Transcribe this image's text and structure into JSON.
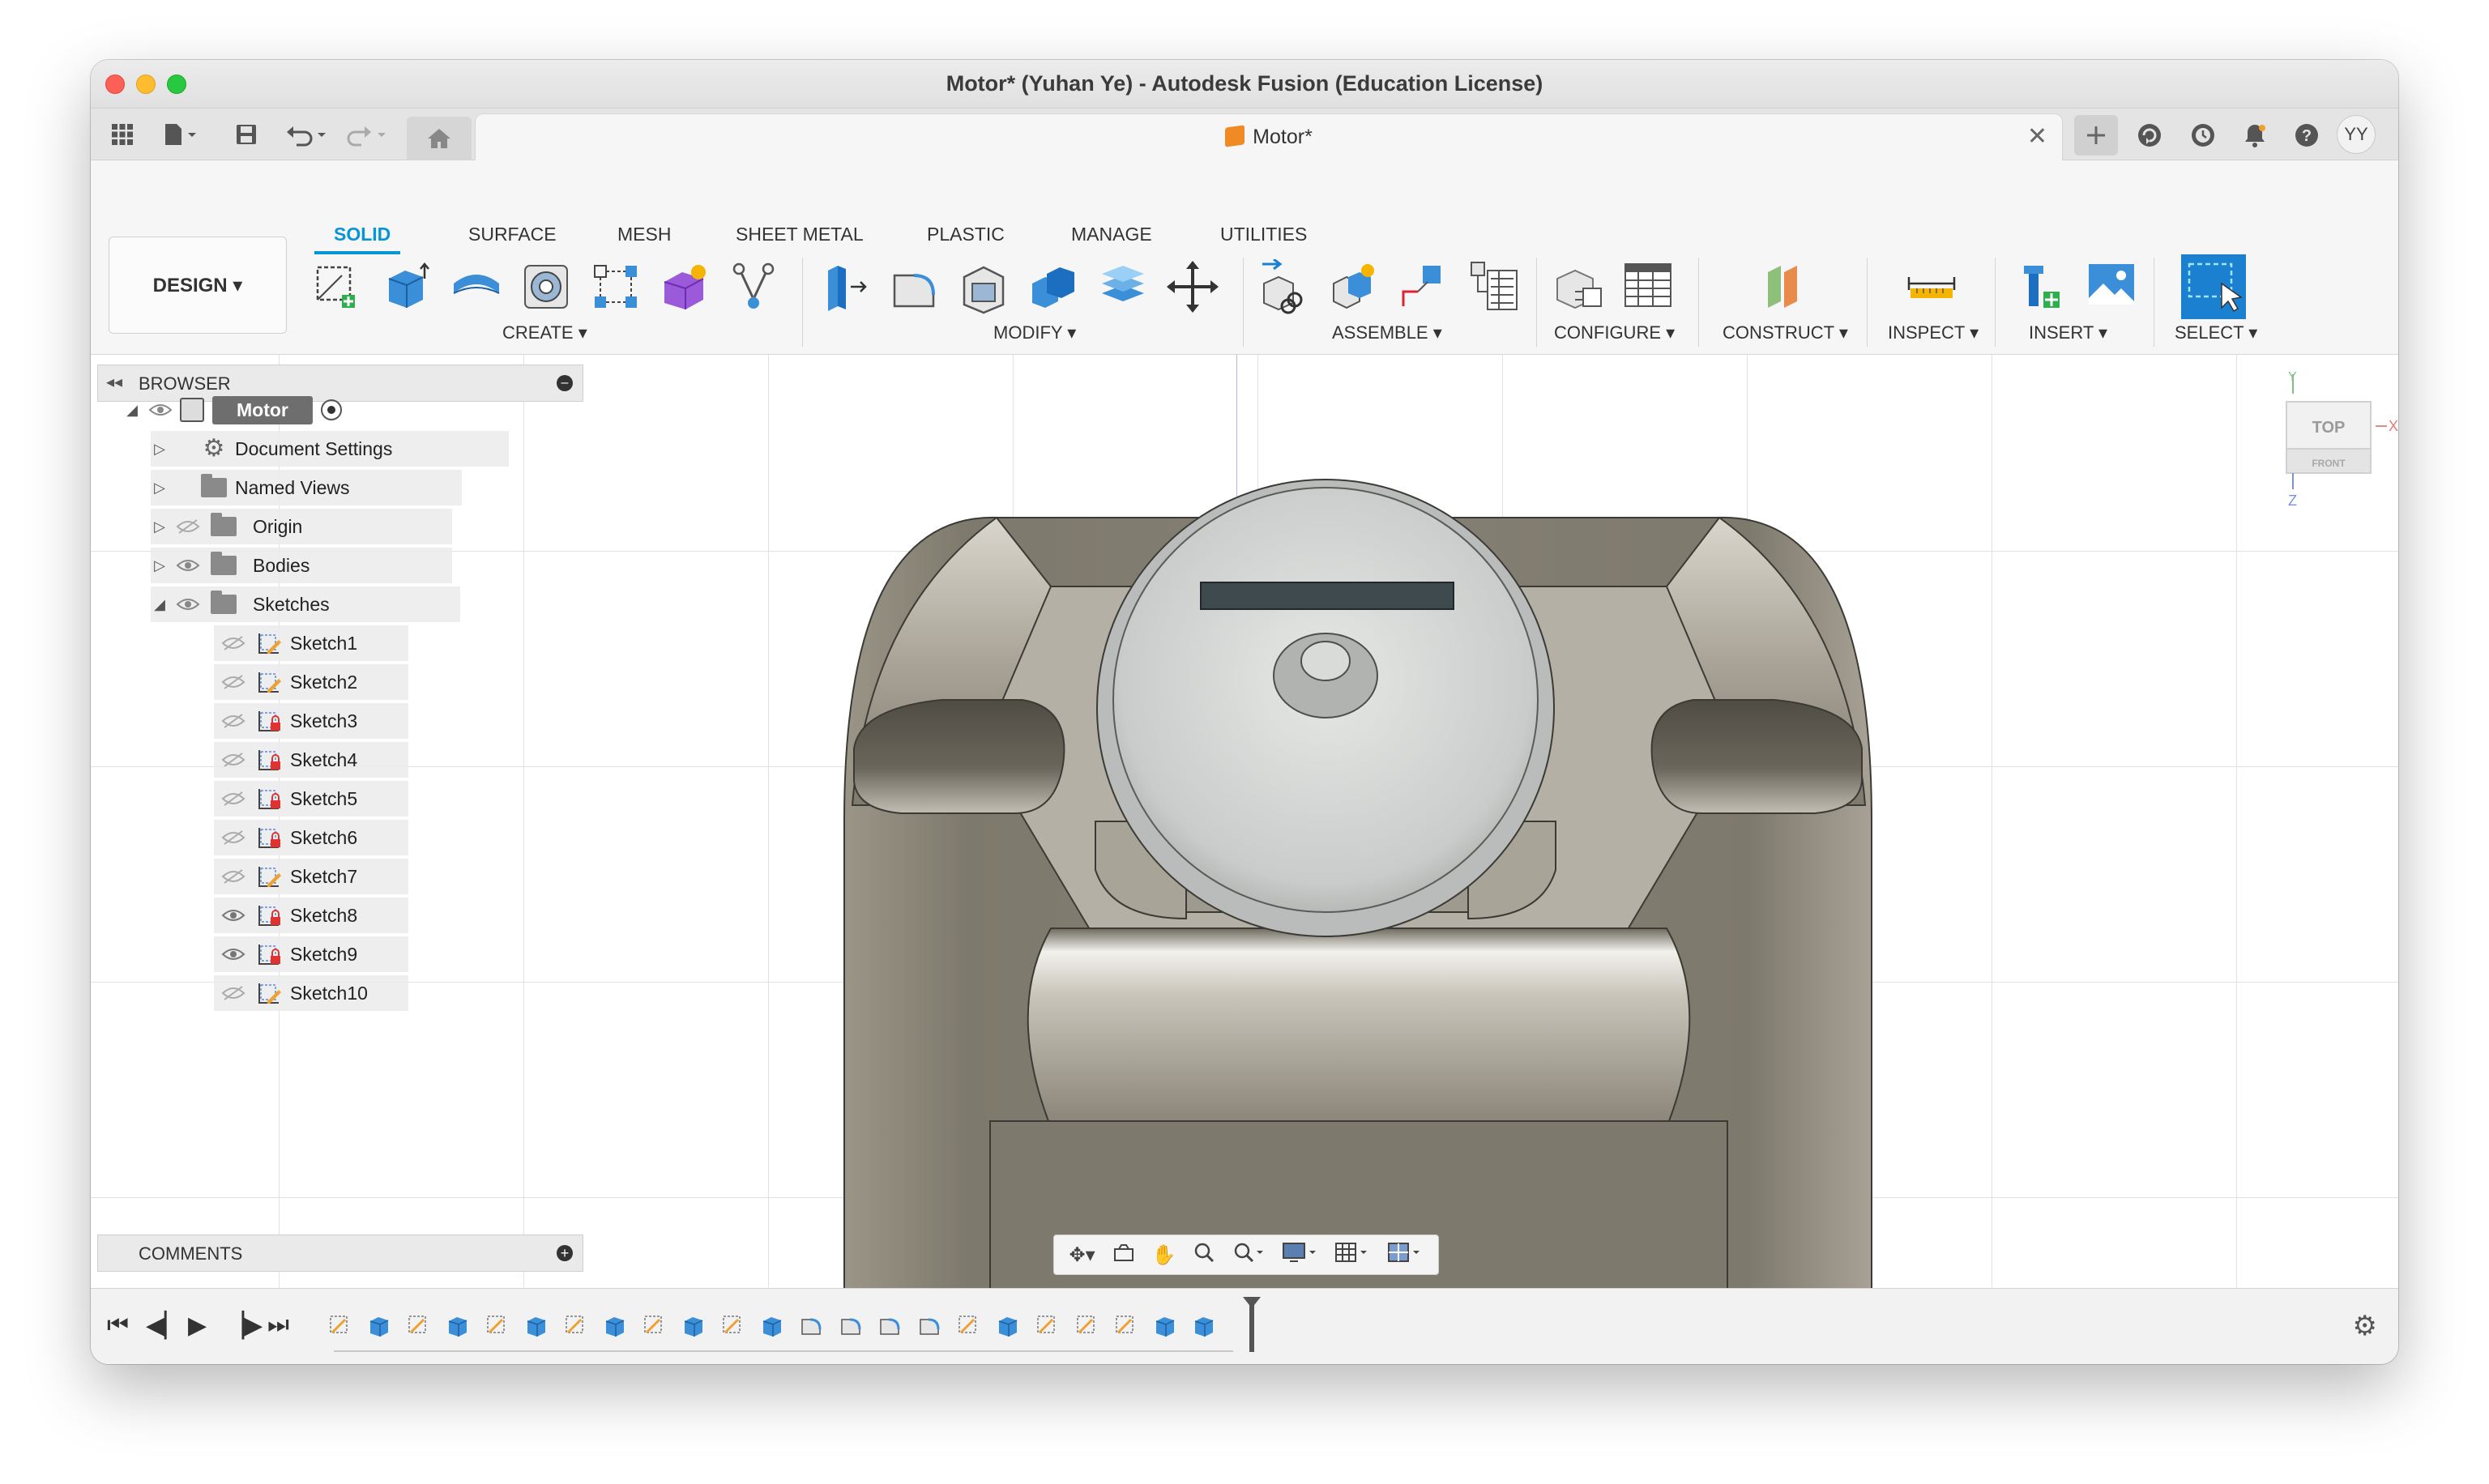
{
  "window": {
    "title": "Motor* (Yuhan Ye) - Autodesk Fusion (Education License)"
  },
  "tabbar": {
    "doc_title": "Motor*",
    "avatar": "YY"
  },
  "workspace": {
    "design_label": "DESIGN ▾"
  },
  "tabs": [
    "SOLID",
    "SURFACE",
    "MESH",
    "SHEET METAL",
    "PLASTIC",
    "MANAGE",
    "UTILITIES"
  ],
  "groups": [
    "CREATE ▾",
    "MODIFY ▾",
    "ASSEMBLE ▾",
    "CONFIGURE ▾",
    "CONSTRUCT ▾",
    "INSPECT ▾",
    "INSERT ▾",
    "SELECT ▾"
  ],
  "browser": {
    "title": "BROWSER",
    "root": "Motor",
    "items": [
      {
        "label": "Document Settings"
      },
      {
        "label": "Named Views"
      },
      {
        "label": "Origin"
      },
      {
        "label": "Bodies"
      },
      {
        "label": "Sketches"
      }
    ],
    "sketches": [
      {
        "label": "Sketch1"
      },
      {
        "label": "Sketch2"
      },
      {
        "label": "Sketch3"
      },
      {
        "label": "Sketch4"
      },
      {
        "label": "Sketch5"
      },
      {
        "label": "Sketch6"
      },
      {
        "label": "Sketch7"
      },
      {
        "label": "Sketch8"
      },
      {
        "label": "Sketch9"
      },
      {
        "label": "Sketch10"
      }
    ]
  },
  "comments": {
    "title": "COMMENTS"
  },
  "viewcube": {
    "top": "TOP",
    "front": "FRONT",
    "axis_x": "X",
    "axis_y": "Y",
    "axis_z": "Z"
  },
  "colors": {
    "accent": "#0696d7",
    "model_metal": "#8a8577",
    "grid": "#dfe3e8"
  }
}
